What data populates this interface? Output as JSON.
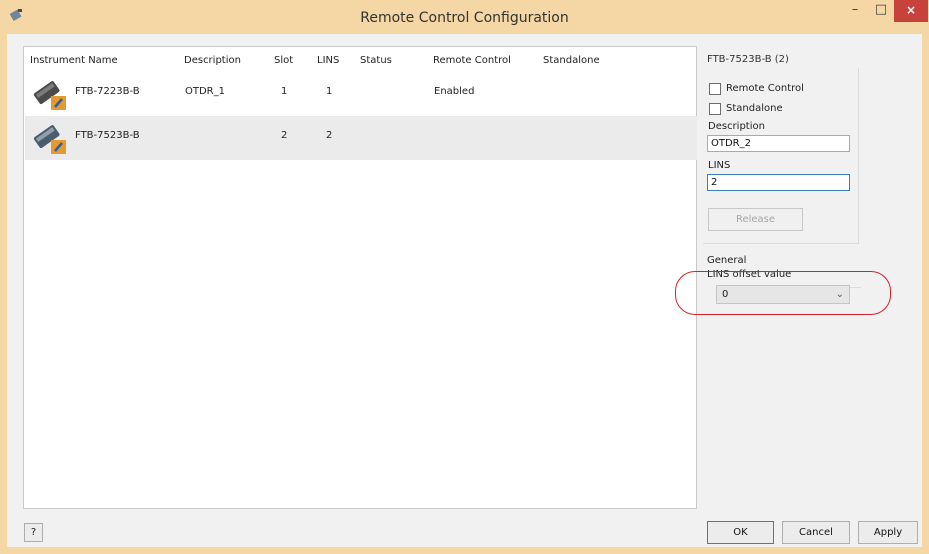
{
  "window": {
    "title": "Remote Control Configuration",
    "minimize_label": "–",
    "maximize_label": "□",
    "close_label": "×",
    "accent_color": "#f4d7a4",
    "close_color": "#c7423b"
  },
  "table": {
    "columns": {
      "instrument_name": "Instrument Name",
      "description": "Description",
      "slot": "Slot",
      "lins": "LINS",
      "status": "Status",
      "remote_control": "Remote Control",
      "standalone": "Standalone"
    },
    "rows": [
      {
        "name": "FTB-7223B-B",
        "description": "OTDR_1",
        "slot": "1",
        "lins": "1",
        "status": "",
        "remote_control": "Enabled",
        "standalone": "",
        "selected": false
      },
      {
        "name": "FTB-7523B-B",
        "description": "",
        "slot": "2",
        "lins": "2",
        "status": "",
        "remote_control": "",
        "standalone": "",
        "selected": true
      }
    ]
  },
  "details": {
    "title": "FTB-7523B-B (2)",
    "remote_control_label": "Remote Control",
    "remote_control_checked": false,
    "standalone_label": "Standalone",
    "standalone_checked": false,
    "description_label": "Description",
    "description_value": "OTDR_2",
    "lins_label": "LINS",
    "lins_value": "2",
    "release_label": "Release"
  },
  "general": {
    "section_label": "General",
    "lins_offset_label": "LINS offset value",
    "lins_offset_value": "0",
    "highlight_color": "#d2232a"
  },
  "footer": {
    "help_label": "?",
    "ok_label": "OK",
    "cancel_label": "Cancel",
    "apply_label": "Apply"
  }
}
